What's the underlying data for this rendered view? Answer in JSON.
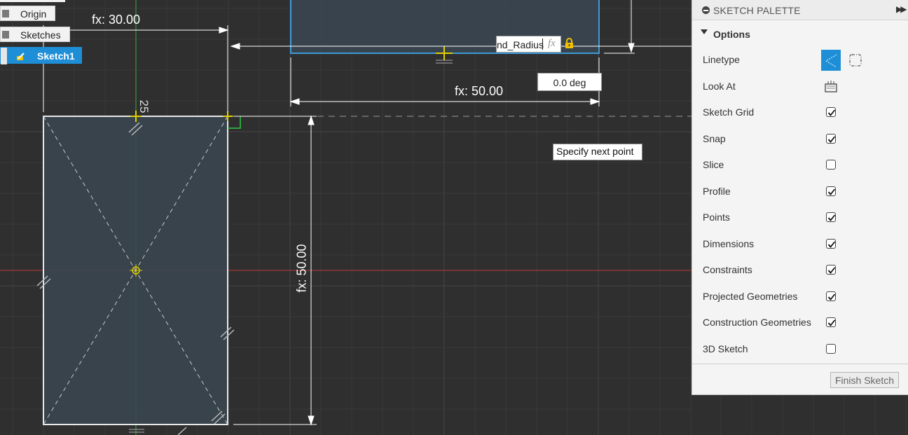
{
  "browser": {
    "items": [
      {
        "label": "Origin"
      },
      {
        "label": "Sketches"
      },
      {
        "label": "Sketch1",
        "active": true
      }
    ]
  },
  "canvas": {
    "dimensions": {
      "top_width": "fx: 30.00",
      "height": "fx: 50.00",
      "upper_width": "fx: 50.00",
      "center_marker": "25"
    },
    "angle_value": "0.0 deg",
    "radius_input": {
      "value": "nd_Radius",
      "fx": "fx"
    },
    "tooltip": "Specify next point",
    "colors": {
      "background": "#2f2f2f",
      "grid": "#3c3c3c",
      "x_axis": "#b83a3a",
      "y_axis": "#3aa83a",
      "profile_fill": "#3a4651",
      "accent": "#1e8fd6"
    }
  },
  "palette": {
    "title": "SKETCH PALETTE",
    "section": "Options",
    "rows": [
      {
        "label": "Linetype",
        "kind": "linetype"
      },
      {
        "label": "Look At",
        "kind": "icon"
      },
      {
        "label": "Sketch Grid",
        "kind": "checkbox",
        "checked": true
      },
      {
        "label": "Snap",
        "kind": "checkbox",
        "checked": true
      },
      {
        "label": "Slice",
        "kind": "checkbox",
        "checked": false
      },
      {
        "label": "Profile",
        "kind": "checkbox",
        "checked": true
      },
      {
        "label": "Points",
        "kind": "checkbox",
        "checked": true
      },
      {
        "label": "Dimensions",
        "kind": "checkbox",
        "checked": true
      },
      {
        "label": "Constraints",
        "kind": "checkbox",
        "checked": true
      },
      {
        "label": "Projected Geometries",
        "kind": "checkbox",
        "checked": true
      },
      {
        "label": "Construction Geometries",
        "kind": "checkbox",
        "checked": true
      },
      {
        "label": "3D Sketch",
        "kind": "checkbox",
        "checked": false
      }
    ],
    "finish_label": "Finish Sketch"
  }
}
